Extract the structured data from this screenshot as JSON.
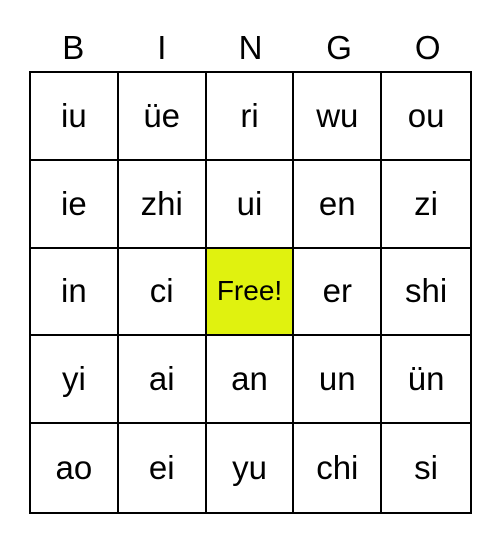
{
  "header": [
    "B",
    "I",
    "N",
    "G",
    "O"
  ],
  "free_color": "#e0f20f",
  "cells": [
    [
      "iu",
      "üe",
      "ri",
      "wu",
      "ou"
    ],
    [
      "ie",
      "zhi",
      "ui",
      "en",
      "zi"
    ],
    [
      "in",
      "ci",
      "Free!",
      "er",
      "shi"
    ],
    [
      "yi",
      "ai",
      "an",
      "un",
      "ün"
    ],
    [
      "ao",
      "ei",
      "yu",
      "chi",
      "si"
    ]
  ]
}
